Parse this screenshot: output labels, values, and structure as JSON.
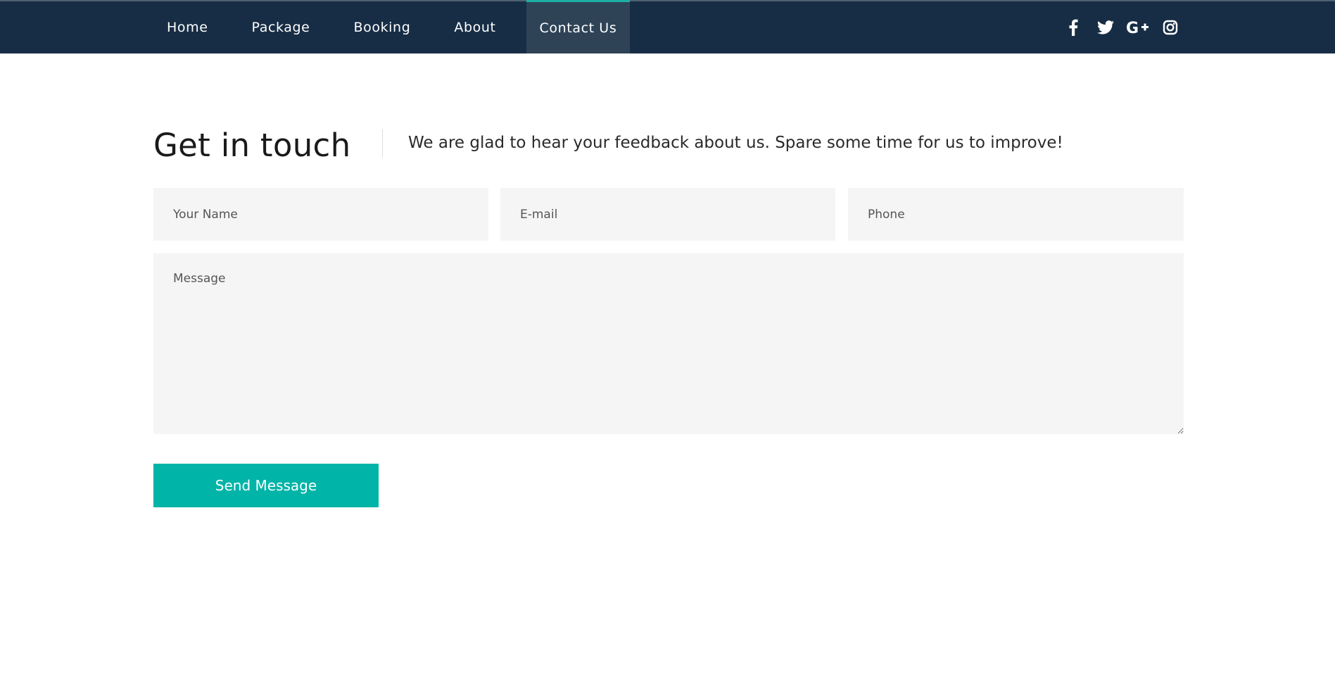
{
  "nav": {
    "items": [
      {
        "label": "Home"
      },
      {
        "label": "Package"
      },
      {
        "label": "Booking"
      },
      {
        "label": "About"
      },
      {
        "label": "Contact Us",
        "active": true
      }
    ],
    "social": [
      "facebook-icon",
      "twitter-icon",
      "google-plus-icon",
      "instagram-icon"
    ]
  },
  "contact": {
    "title": "Get in touch",
    "tagline": "We are glad to hear your feedback about us. Spare some time for us to improve!",
    "name_placeholder": "Your Name",
    "email_placeholder": "E-mail",
    "phone_placeholder": "Phone",
    "message_placeholder": "Message",
    "send_label": "Send Message"
  },
  "colors": {
    "navbar": "#172d45",
    "nav_active": "#2f4357",
    "accent": "#00b4a7",
    "field_bg": "#f5f5f5"
  }
}
